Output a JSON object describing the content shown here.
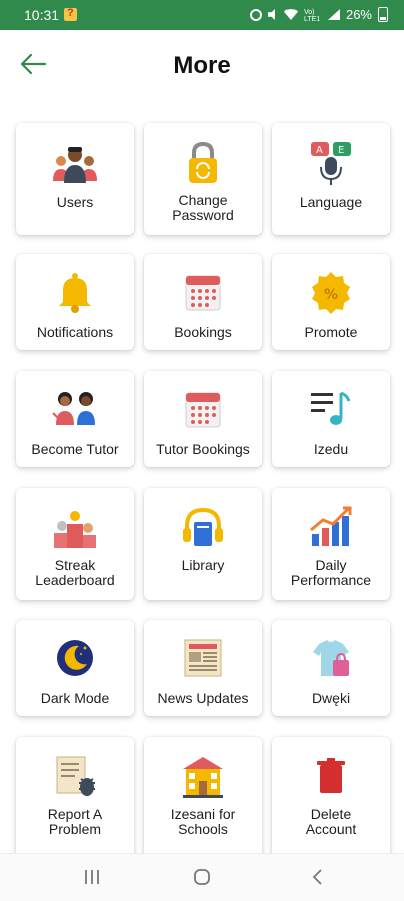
{
  "status_bar": {
    "time": "10:31",
    "volte": "Vo) LTE1",
    "battery_text": "26%"
  },
  "header": {
    "title": "More"
  },
  "tiles": [
    {
      "label": "Users",
      "icon": "users-icon"
    },
    {
      "label": "Change\nPassword",
      "icon": "padlock-icon"
    },
    {
      "label": "Language",
      "icon": "language-icon"
    },
    {
      "label": "Notifications",
      "icon": "bell-icon"
    },
    {
      "label": "Bookings",
      "icon": "calendar-icon"
    },
    {
      "label": "Promote",
      "icon": "promote-badge-icon"
    },
    {
      "label": "Become Tutor",
      "icon": "tutor-icon"
    },
    {
      "label": "Tutor Bookings",
      "icon": "calendar-icon"
    },
    {
      "label": "Izedu",
      "icon": "music-list-icon"
    },
    {
      "label": "Streak\nLeaderboard",
      "icon": "podium-icon"
    },
    {
      "label": "Library",
      "icon": "headphones-book-icon"
    },
    {
      "label": "Daily\nPerformance",
      "icon": "bar-chart-icon"
    },
    {
      "label": "Dark Mode",
      "icon": "moon-icon"
    },
    {
      "label": "News Updates",
      "icon": "newspaper-icon"
    },
    {
      "label": "Dwęki",
      "icon": "shirt-icon"
    },
    {
      "label": "Report A\nProblem",
      "icon": "bug-report-icon"
    },
    {
      "label": "Izesani for\nSchools",
      "icon": "school-icon"
    },
    {
      "label": "Delete\nAccount",
      "icon": "trash-icon"
    }
  ],
  "colors": {
    "status_bar": "#2f8a4c",
    "accent": "#2f8a4c"
  }
}
